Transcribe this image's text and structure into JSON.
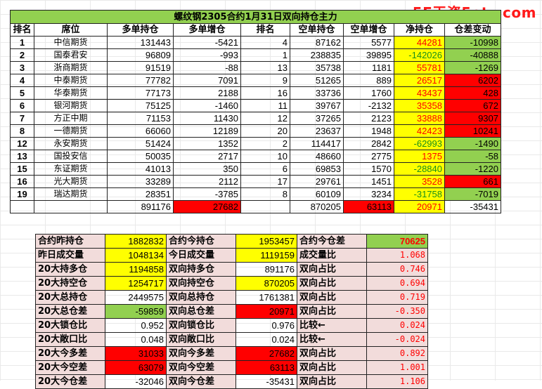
{
  "watermark": "5E天资5etz.com",
  "title": "螺纹钢2305合约1月31日双向持仓主力",
  "headers": [
    "排名",
    "席位",
    "多单持仓",
    "多单增仓",
    "排名",
    "空单持仓",
    "空单增仓",
    "净持仓",
    "仓差变动"
  ],
  "rows": [
    [
      "1",
      "中信期货",
      "131443",
      "-5421",
      "4",
      "87162",
      "5577",
      "44281",
      "-10998"
    ],
    [
      "2",
      "国泰君安",
      "96809",
      "-993",
      "1",
      "238835",
      "39895",
      "-142026",
      "-40888"
    ],
    [
      "3",
      "浙商期货",
      "91519",
      "-88",
      "13",
      "35738",
      "1181",
      "55781",
      "-1269"
    ],
    [
      "4",
      "中泰期货",
      "77782",
      "7091",
      "9",
      "51265",
      "889",
      "26517",
      "6202"
    ],
    [
      "5",
      "华泰期货",
      "77173",
      "2188",
      "16",
      "33736",
      "1760",
      "43437",
      "428"
    ],
    [
      "6",
      "银河期货",
      "75125",
      "-1460",
      "11",
      "39767",
      "-2132",
      "35358",
      "672"
    ],
    [
      "7",
      "方正中期",
      "71153",
      "11430",
      "12",
      "37265",
      "2123",
      "33888",
      "9307"
    ],
    [
      "8",
      "一德期货",
      "66060",
      "12189",
      "20",
      "23637",
      "1948",
      "42423",
      "10241"
    ],
    [
      "12",
      "永安期货",
      "51424",
      "1352",
      "2",
      "114417",
      "2842",
      "-62993",
      "-1490"
    ],
    [
      "13",
      "国投安信",
      "50035",
      "2717",
      "10",
      "48660",
      "2775",
      "1375",
      "-58"
    ],
    [
      "15",
      "东证期货",
      "41013",
      "350",
      "6",
      "69853",
      "1570",
      "-28840",
      "-1220"
    ],
    [
      "16",
      "光大期货",
      "33289",
      "2112",
      "17",
      "29761",
      "1451",
      "3528",
      "661"
    ],
    [
      "19",
      "瑞达期货",
      "28351",
      "-3785",
      "8",
      "60109",
      "3234",
      "-31758",
      "-7019"
    ]
  ],
  "totals": [
    "",
    "",
    "891176",
    "27682",
    "",
    "870205",
    "63113",
    "20971",
    "-35431"
  ],
  "summary": [
    [
      "合约昨持仓",
      "1882832",
      "合约今持仓",
      "1953457",
      "合约今仓差",
      "70625"
    ],
    [
      "昨日成交量",
      "1048134",
      "今日成交量",
      "1119159",
      "成交量比",
      "1.068"
    ],
    [
      "20大持多仓",
      "1194858",
      "双向持多仓",
      "891176",
      "双向占比",
      "0.746"
    ],
    [
      "20大持空仓",
      "1254717",
      "双向持空仓",
      "870205",
      "双向占比",
      "0.694"
    ],
    [
      "20大总持仓",
      "2449575",
      "双向总持仓",
      "1761381",
      "双向占比",
      "0.719"
    ],
    [
      "20大总仓差",
      "-59859",
      "双向总仓差",
      "20971",
      "双向占比",
      "-0.350"
    ],
    [
      "20大锁仓比",
      "0.952",
      "双向锁仓比",
      "0.976",
      "比较←",
      "0.024"
    ],
    [
      "20大敞口比",
      "0.048",
      "双向敞口比",
      "0.024",
      "比较←",
      "-0.024"
    ],
    [
      "20大今多差",
      "31033",
      "双向今多差",
      "27682",
      "双向占比",
      "0.892"
    ],
    [
      "20大今空差",
      "63079",
      "双向今空差",
      "63113",
      "双向占比",
      "1.001"
    ],
    [
      "20大今仓差",
      "-32046",
      "双向今仓差",
      "-35431",
      "双向占比",
      "1.106"
    ]
  ],
  "colors": {
    "yellow": "#ffff00",
    "green": "#92d050",
    "red": "#ff0000",
    "pink": "#f2dcdb"
  }
}
